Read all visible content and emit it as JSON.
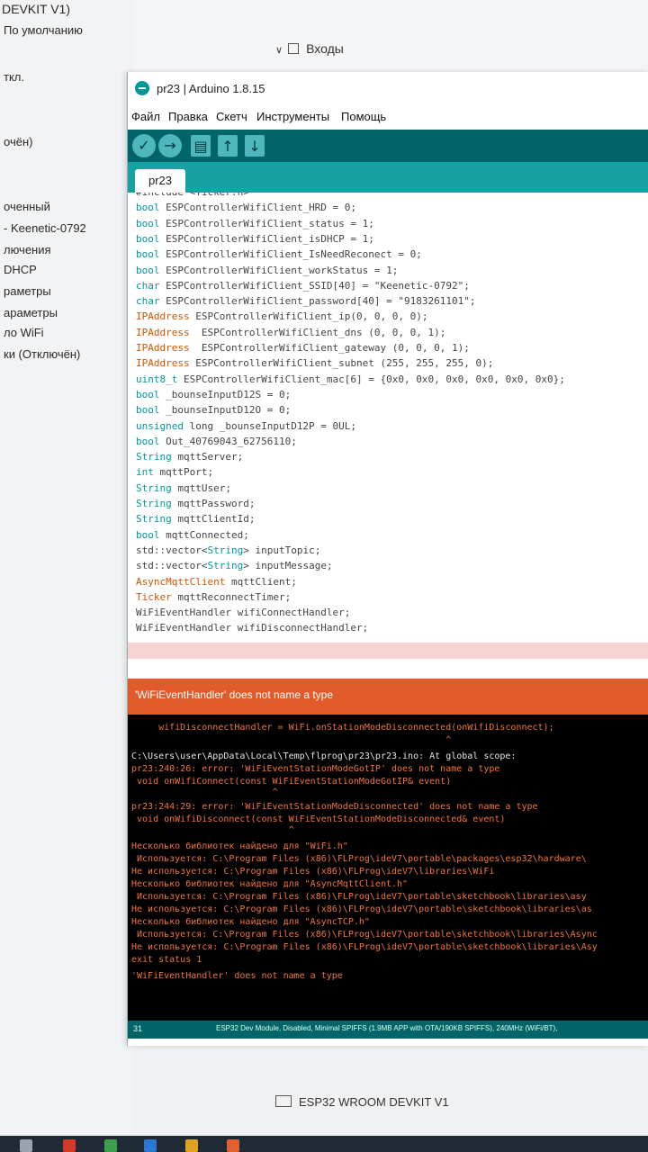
{
  "background_window": {
    "title_fragment": "DEVKIT V1)",
    "left_labels": [
      "По умолчанию",
      "ткл.",
      "очён)",
      "оченный",
      "- Keenetic-0792",
      "лючения",
      "DHCP",
      "раметры",
      "араметры",
      "ло WiFi",
      "ки (Отключён)"
    ],
    "section_header": "Входы",
    "board_item": "ESP32 WROOM DEVKIT V1"
  },
  "ide": {
    "title": "pr23 | Arduino 1.8.15",
    "menu": [
      "Файл",
      "Правка",
      "Скетч",
      "Инструменты",
      "Помощь"
    ],
    "toolbar": {
      "verify_icon": "check-icon",
      "upload_icon": "arrow-right-icon",
      "new_icon": "document-icon",
      "open_icon": "arrow-up-icon",
      "save_icon": "arrow-down-icon"
    },
    "tab": "pr23",
    "code_lines": [
      "#include <Ticker.h>",
      "bool ESPControllerWifiClient_HRD = 0;",
      "bool ESPControllerWifiClient_status = 1;",
      "bool ESPControllerWifiClient_isDHCP = 1;",
      "bool ESPControllerWifiClient_IsNeedReconect = 0;",
      "bool ESPControllerWifiClient_workStatus = 1;",
      "char ESPControllerWifiClient_SSID[40] = \"Keenetic-0792\";",
      "char ESPControllerWifiClient_password[40] = \"9183261101\";",
      "IPAddress ESPControllerWifiClient_ip(0, 0, 0, 0);",
      "IPAddress  ESPControllerWifiClient_dns (0, 0, 0, 1);",
      "IPAddress  ESPControllerWifiClient_gateway (0, 0, 0, 1);",
      "IPAddress ESPControllerWifiClient_subnet (255, 255, 255, 0);",
      "uint8_t ESPControllerWifiClient_mac[6] = {0x0, 0x0, 0x0, 0x0, 0x0, 0x0};",
      "bool _bounseInputD12S = 0;",
      "bool _bounseInputD12O = 0;",
      "unsigned long _bounseInputD12P = 0UL;",
      "bool Out_40769043_62756110;",
      "String mqttServer;",
      "int mqttPort;",
      "String mqttUser;",
      "String mqttPassword;",
      "String mqttClientId;",
      "bool mqttConnected;",
      "std::vector<String> inputTopic;",
      "std::vector<String> inputMessage;",
      "AsyncMqttClient mqttClient;",
      "Ticker mqttReconnectTimer;",
      "WiFiEventHandler wifiConnectHandler;",
      "WiFiEventHandler wifiDisconnectHandler;"
    ],
    "error_message": "'WiFiEventHandler' does not name a type",
    "console_lines": [
      "     wifiDisconnectHandler = WiFi.onStationModeDisconnected(onWifiDisconnect);",
      "                                                          ^",
      "C:\\Users\\user\\AppData\\Local\\Temp\\flprog\\pr23\\pr23.ino: At global scope:",
      "pr23:240:26: error: 'WiFiEventStationModeGotIP' does not name a type",
      " void onWifiConnect(const WiFiEventStationModeGotIP& event)",
      "                          ^",
      "pr23:244:29: error: 'WiFiEventStationModeDisconnected' does not name a type",
      " void onWifiDisconnect(const WiFiEventStationModeDisconnected& event)",
      "                             ^",
      "Несколько библиотек найдено для \"WiFi.h\"",
      " Используется: C:\\Program Files (x86)\\FLProg\\ideV7\\portable\\packages\\esp32\\hardware\\",
      "Не используется: C:\\Program Files (x86)\\FLProg\\ideV7\\libraries\\WiFi",
      "Несколько библиотек найдено для \"AsyncMqttClient.h\"",
      " Используется: C:\\Program Files (x86)\\FLProg\\ideV7\\portable\\sketchbook\\libraries\\asy",
      "Не используется: C:\\Program Files (x86)\\FLProg\\ideV7\\portable\\sketchbook\\libraries\\as",
      "Несколько библиотек найдено для \"AsyncTCP.h\"",
      " Используется: C:\\Program Files (x86)\\FLProg\\ideV7\\portable\\sketchbook\\libraries\\Async",
      "Не используется: C:\\Program Files (x86)\\FLProg\\ideV7\\portable\\sketchbook\\libraries\\Asy",
      "exit status 1",
      "'WiFiEventHandler' does not name a type"
    ],
    "status_line_number": "31",
    "status_board": "ESP32 Dev Module, Disabled, Minimal SPIFFS (1.9MB APP with OTA/190KB SPIFFS), 240MHz (WiFi/BT),"
  },
  "colors": {
    "toolbar": "#006468",
    "tabbar": "#17a1a5",
    "error_bar": "#e25a2a",
    "console_error_text": "#f0753a"
  }
}
